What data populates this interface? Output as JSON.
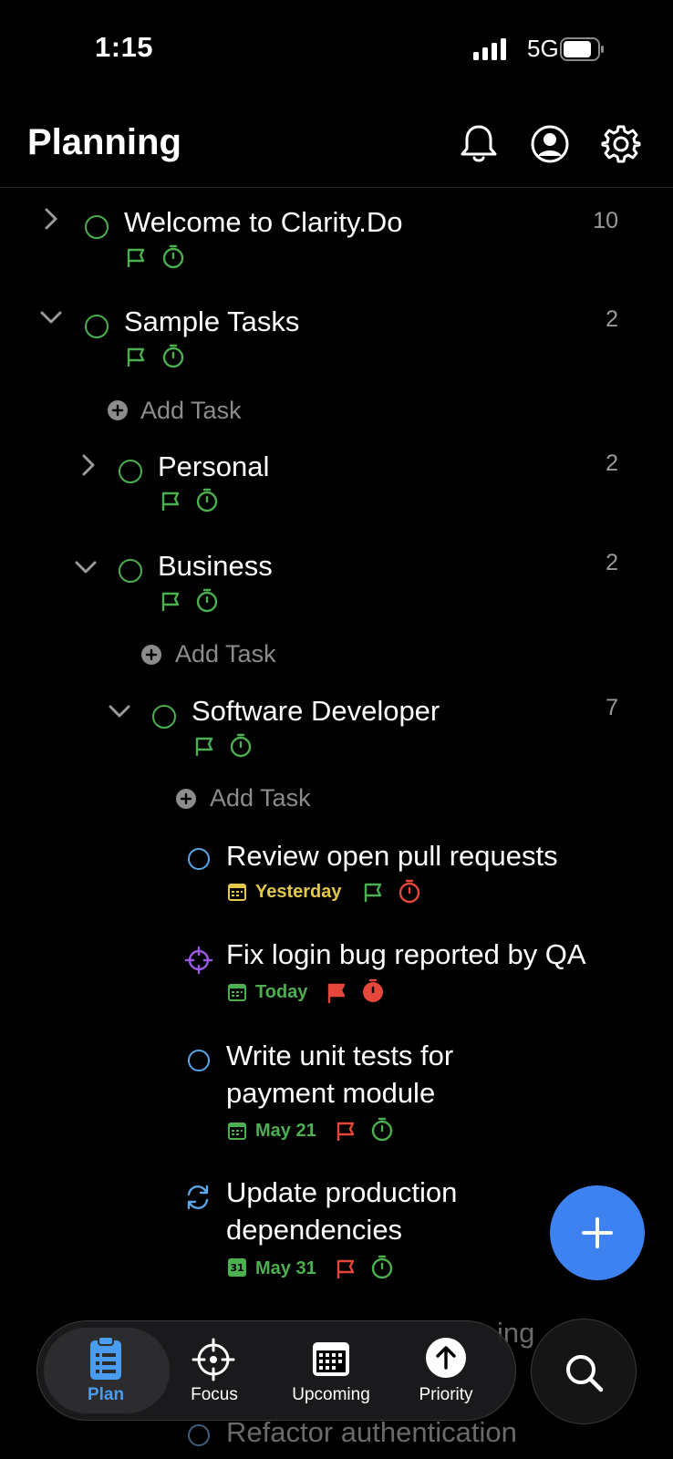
{
  "status_bar": {
    "time": "1:15",
    "network": "5G"
  },
  "header": {
    "title": "Planning"
  },
  "tasks": [
    {
      "title": "Welcome to Clarity.Do",
      "count": "10"
    },
    {
      "title": "Sample Tasks",
      "count": "2",
      "add_label": "Add Task"
    },
    {
      "title": "Personal",
      "count": "2"
    },
    {
      "title": "Business",
      "count": "2",
      "add_label": "Add Task"
    },
    {
      "title": "Software Developer",
      "count": "7",
      "add_label": "Add Task"
    },
    {
      "title": "Review open pull requests",
      "date": "Yesterday"
    },
    {
      "title": "Fix login bug reported by QA",
      "date": "Today"
    },
    {
      "title_line1": "Write unit tests for",
      "title_line2": "payment module",
      "date": "May 21"
    },
    {
      "title_line1": "Update production",
      "title_line2": "dependencies",
      "date": "May 31",
      "calendar_day": "31"
    },
    {
      "title_partial": "ing"
    },
    {
      "title": "Refactor authentication"
    }
  ],
  "tabs": [
    {
      "label": "Plan",
      "icon": "clipboard-list-icon",
      "active": true
    },
    {
      "label": "Focus",
      "icon": "crosshair-icon"
    },
    {
      "label": "Upcoming",
      "icon": "calendar-grid-icon"
    },
    {
      "label": "Priority",
      "icon": "arrow-up-circle-icon"
    }
  ],
  "colors": {
    "accent_blue": "#3d82f0",
    "green": "#4caf50",
    "red": "#e5483b",
    "yellow": "#e3c84a",
    "purple": "#9b59e6",
    "tab_blue": "#4a9cf0"
  }
}
